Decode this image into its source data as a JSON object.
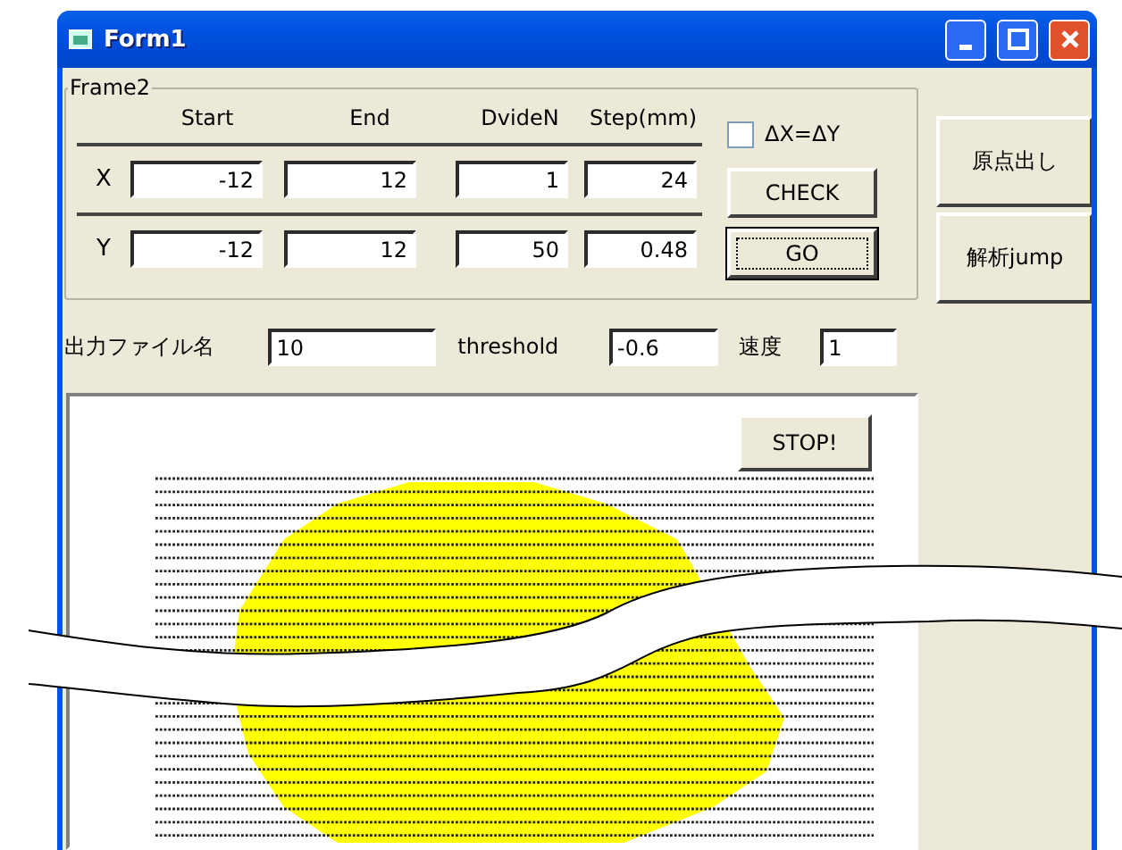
{
  "window": {
    "title": "Form1"
  },
  "frame": {
    "label": "Frame2",
    "columns": [
      "Start",
      "End",
      "DvideN",
      "Step(mm)"
    ],
    "rows": [
      {
        "label": "X",
        "values": [
          "-12",
          "12",
          "1",
          "24"
        ]
      },
      {
        "label": "Y",
        "values": [
          "-12",
          "12",
          "50",
          "0.48"
        ]
      }
    ],
    "checkbox": {
      "label": "ΔX=ΔY",
      "checked": false
    },
    "buttons": [
      {
        "label": "CHECK",
        "focused": false
      },
      {
        "label": "GO",
        "focused": true
      }
    ]
  },
  "side_buttons": [
    "原点出し",
    "解析jump"
  ],
  "settings": [
    {
      "label": "出力ファイル名",
      "value": "10"
    },
    {
      "label": "threshold",
      "value": "-0.6"
    },
    {
      "label": "速度",
      "value": "1"
    }
  ],
  "plot": {
    "stop_button": "STOP!"
  }
}
